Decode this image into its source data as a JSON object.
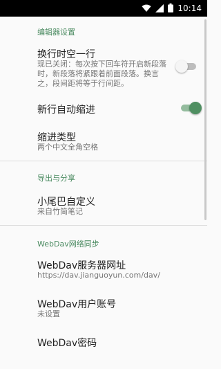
{
  "status_bar": {
    "time": "10:14",
    "icons": [
      "wifi-icon",
      "cellular-signal-icon",
      "battery-icon"
    ]
  },
  "sections": {
    "editor": {
      "header": "编辑器设置",
      "blank_line": {
        "title": "换行时空一行",
        "summary_lines": [
          "现已关闭：每次按下回车符开启新段落",
          "时，新段落将紧跟着前面段落。换言",
          "之，段间距将等于行间距。"
        ],
        "enabled": false
      },
      "auto_indent": {
        "title": "新行自动缩进",
        "enabled": true
      },
      "indent_type": {
        "title": "缩进类型",
        "summary": "两个中文全角空格"
      }
    },
    "export": {
      "header": "导出与分享",
      "tail": {
        "title": "小尾巴自定义",
        "summary": "来自竹简笔记"
      }
    },
    "webdav": {
      "header": "WebDav网络同步",
      "server": {
        "title": "WebDav服务器网址",
        "summary": "https://dav.jianguoyun.com/dav/"
      },
      "account": {
        "title": "WebDav用户账号",
        "summary": "未设置"
      },
      "password": {
        "title": "WebDav密码"
      }
    }
  },
  "colors": {
    "accent": "#4f8f61",
    "section_header": "#4a8a60",
    "background": "#fafafa"
  }
}
